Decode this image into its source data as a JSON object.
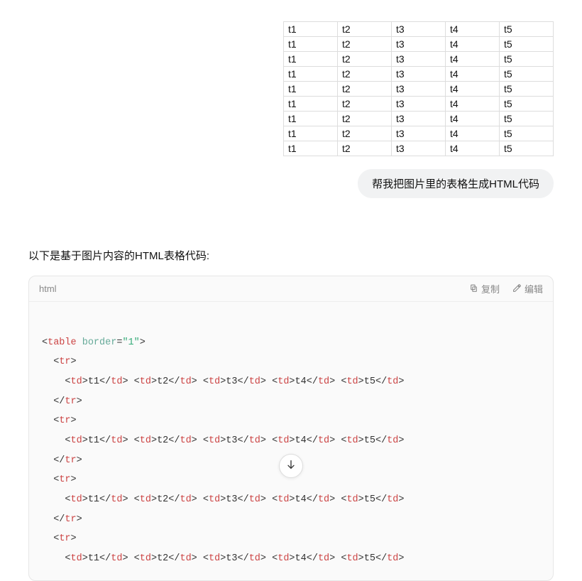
{
  "user": {
    "table_rows": [
      [
        "t1",
        "t2",
        "t3",
        "t4",
        "t5"
      ],
      [
        "t1",
        "t2",
        "t3",
        "t4",
        "t5"
      ],
      [
        "t1",
        "t2",
        "t3",
        "t4",
        "t5"
      ],
      [
        "t1",
        "t2",
        "t3",
        "t4",
        "t5"
      ],
      [
        "t1",
        "t2",
        "t3",
        "t4",
        "t5"
      ],
      [
        "t1",
        "t2",
        "t3",
        "t4",
        "t5"
      ],
      [
        "t1",
        "t2",
        "t3",
        "t4",
        "t5"
      ],
      [
        "t1",
        "t2",
        "t3",
        "t4",
        "t5"
      ],
      [
        "t1",
        "t2",
        "t3",
        "t4",
        "t5"
      ]
    ],
    "message": "帮我把图片里的表格生成HTML代码"
  },
  "assistant": {
    "intro": "以下是基于图片内容的HTML表格代码:",
    "code_lang": "html",
    "copy_label": "复制",
    "edit_label": "编辑",
    "code_lines": [
      "",
      [
        {
          "t": "brack",
          "v": "<"
        },
        {
          "t": "tag",
          "v": "table"
        },
        {
          "t": "text",
          "v": " "
        },
        {
          "t": "attr",
          "v": "border"
        },
        {
          "t": "text",
          "v": "="
        },
        {
          "t": "str",
          "v": "\"1\""
        },
        {
          "t": "brack",
          "v": ">"
        }
      ],
      [
        {
          "t": "text",
          "v": "  "
        },
        {
          "t": "brack",
          "v": "<"
        },
        {
          "t": "tag",
          "v": "tr"
        },
        {
          "t": "brack",
          "v": ">"
        }
      ],
      [
        {
          "t": "text",
          "v": "    "
        },
        {
          "t": "brack",
          "v": "<"
        },
        {
          "t": "tag",
          "v": "td"
        },
        {
          "t": "brack",
          "v": ">"
        },
        {
          "t": "text",
          "v": "t1"
        },
        {
          "t": "brack",
          "v": "</"
        },
        {
          "t": "tag",
          "v": "td"
        },
        {
          "t": "brack",
          "v": "> "
        },
        {
          "t": "brack",
          "v": "<"
        },
        {
          "t": "tag",
          "v": "td"
        },
        {
          "t": "brack",
          "v": ">"
        },
        {
          "t": "text",
          "v": "t2"
        },
        {
          "t": "brack",
          "v": "</"
        },
        {
          "t": "tag",
          "v": "td"
        },
        {
          "t": "brack",
          "v": "> "
        },
        {
          "t": "brack",
          "v": "<"
        },
        {
          "t": "tag",
          "v": "td"
        },
        {
          "t": "brack",
          "v": ">"
        },
        {
          "t": "text",
          "v": "t3"
        },
        {
          "t": "brack",
          "v": "</"
        },
        {
          "t": "tag",
          "v": "td"
        },
        {
          "t": "brack",
          "v": "> "
        },
        {
          "t": "brack",
          "v": "<"
        },
        {
          "t": "tag",
          "v": "td"
        },
        {
          "t": "brack",
          "v": ">"
        },
        {
          "t": "text",
          "v": "t4"
        },
        {
          "t": "brack",
          "v": "</"
        },
        {
          "t": "tag",
          "v": "td"
        },
        {
          "t": "brack",
          "v": "> "
        },
        {
          "t": "brack",
          "v": "<"
        },
        {
          "t": "tag",
          "v": "td"
        },
        {
          "t": "brack",
          "v": ">"
        },
        {
          "t": "text",
          "v": "t5"
        },
        {
          "t": "brack",
          "v": "</"
        },
        {
          "t": "tag",
          "v": "td"
        },
        {
          "t": "brack",
          "v": ">"
        }
      ],
      [
        {
          "t": "text",
          "v": "  "
        },
        {
          "t": "brack",
          "v": "</"
        },
        {
          "t": "tag",
          "v": "tr"
        },
        {
          "t": "brack",
          "v": ">"
        }
      ],
      [
        {
          "t": "text",
          "v": "  "
        },
        {
          "t": "brack",
          "v": "<"
        },
        {
          "t": "tag",
          "v": "tr"
        },
        {
          "t": "brack",
          "v": ">"
        }
      ],
      [
        {
          "t": "text",
          "v": "    "
        },
        {
          "t": "brack",
          "v": "<"
        },
        {
          "t": "tag",
          "v": "td"
        },
        {
          "t": "brack",
          "v": ">"
        },
        {
          "t": "text",
          "v": "t1"
        },
        {
          "t": "brack",
          "v": "</"
        },
        {
          "t": "tag",
          "v": "td"
        },
        {
          "t": "brack",
          "v": "> "
        },
        {
          "t": "brack",
          "v": "<"
        },
        {
          "t": "tag",
          "v": "td"
        },
        {
          "t": "brack",
          "v": ">"
        },
        {
          "t": "text",
          "v": "t2"
        },
        {
          "t": "brack",
          "v": "</"
        },
        {
          "t": "tag",
          "v": "td"
        },
        {
          "t": "brack",
          "v": "> "
        },
        {
          "t": "brack",
          "v": "<"
        },
        {
          "t": "tag",
          "v": "td"
        },
        {
          "t": "brack",
          "v": ">"
        },
        {
          "t": "text",
          "v": "t3"
        },
        {
          "t": "brack",
          "v": "</"
        },
        {
          "t": "tag",
          "v": "td"
        },
        {
          "t": "brack",
          "v": "> "
        },
        {
          "t": "brack",
          "v": "<"
        },
        {
          "t": "tag",
          "v": "td"
        },
        {
          "t": "brack",
          "v": ">"
        },
        {
          "t": "text",
          "v": "t4"
        },
        {
          "t": "brack",
          "v": "</"
        },
        {
          "t": "tag",
          "v": "td"
        },
        {
          "t": "brack",
          "v": "> "
        },
        {
          "t": "brack",
          "v": "<"
        },
        {
          "t": "tag",
          "v": "td"
        },
        {
          "t": "brack",
          "v": ">"
        },
        {
          "t": "text",
          "v": "t5"
        },
        {
          "t": "brack",
          "v": "</"
        },
        {
          "t": "tag",
          "v": "td"
        },
        {
          "t": "brack",
          "v": ">"
        }
      ],
      [
        {
          "t": "text",
          "v": "  "
        },
        {
          "t": "brack",
          "v": "</"
        },
        {
          "t": "tag",
          "v": "tr"
        },
        {
          "t": "brack",
          "v": ">"
        }
      ],
      [
        {
          "t": "text",
          "v": "  "
        },
        {
          "t": "brack",
          "v": "<"
        },
        {
          "t": "tag",
          "v": "tr"
        },
        {
          "t": "brack",
          "v": ">"
        }
      ],
      [
        {
          "t": "text",
          "v": "    "
        },
        {
          "t": "brack",
          "v": "<"
        },
        {
          "t": "tag",
          "v": "td"
        },
        {
          "t": "brack",
          "v": ">"
        },
        {
          "t": "text",
          "v": "t1"
        },
        {
          "t": "brack",
          "v": "</"
        },
        {
          "t": "tag",
          "v": "td"
        },
        {
          "t": "brack",
          "v": "> "
        },
        {
          "t": "brack",
          "v": "<"
        },
        {
          "t": "tag",
          "v": "td"
        },
        {
          "t": "brack",
          "v": ">"
        },
        {
          "t": "text",
          "v": "t2"
        },
        {
          "t": "brack",
          "v": "</"
        },
        {
          "t": "tag",
          "v": "td"
        },
        {
          "t": "brack",
          "v": "> "
        },
        {
          "t": "brack",
          "v": "<"
        },
        {
          "t": "tag",
          "v": "td"
        },
        {
          "t": "brack",
          "v": ">"
        },
        {
          "t": "text",
          "v": "t3"
        },
        {
          "t": "brack",
          "v": "</"
        },
        {
          "t": "tag",
          "v": "td"
        },
        {
          "t": "brack",
          "v": "> "
        },
        {
          "t": "brack",
          "v": "<"
        },
        {
          "t": "tag",
          "v": "td"
        },
        {
          "t": "brack",
          "v": ">"
        },
        {
          "t": "text",
          "v": "t4"
        },
        {
          "t": "brack",
          "v": "</"
        },
        {
          "t": "tag",
          "v": "td"
        },
        {
          "t": "brack",
          "v": "> "
        },
        {
          "t": "brack",
          "v": "<"
        },
        {
          "t": "tag",
          "v": "td"
        },
        {
          "t": "brack",
          "v": ">"
        },
        {
          "t": "text",
          "v": "t5"
        },
        {
          "t": "brack",
          "v": "</"
        },
        {
          "t": "tag",
          "v": "td"
        },
        {
          "t": "brack",
          "v": ">"
        }
      ],
      [
        {
          "t": "text",
          "v": "  "
        },
        {
          "t": "brack",
          "v": "</"
        },
        {
          "t": "tag",
          "v": "tr"
        },
        {
          "t": "brack",
          "v": ">"
        }
      ],
      [
        {
          "t": "text",
          "v": "  "
        },
        {
          "t": "brack",
          "v": "<"
        },
        {
          "t": "tag",
          "v": "tr"
        },
        {
          "t": "brack",
          "v": ">"
        }
      ],
      [
        {
          "t": "text",
          "v": "    "
        },
        {
          "t": "brack",
          "v": "<"
        },
        {
          "t": "tag",
          "v": "td"
        },
        {
          "t": "brack",
          "v": ">"
        },
        {
          "t": "text",
          "v": "t1"
        },
        {
          "t": "brack",
          "v": "</"
        },
        {
          "t": "tag",
          "v": "td"
        },
        {
          "t": "brack",
          "v": "> "
        },
        {
          "t": "brack",
          "v": "<"
        },
        {
          "t": "tag",
          "v": "td"
        },
        {
          "t": "brack",
          "v": ">"
        },
        {
          "t": "text",
          "v": "t2"
        },
        {
          "t": "brack",
          "v": "</"
        },
        {
          "t": "tag",
          "v": "td"
        },
        {
          "t": "brack",
          "v": "> "
        },
        {
          "t": "brack",
          "v": "<"
        },
        {
          "t": "tag",
          "v": "td"
        },
        {
          "t": "brack",
          "v": ">"
        },
        {
          "t": "text",
          "v": "t3"
        },
        {
          "t": "brack",
          "v": "</"
        },
        {
          "t": "tag",
          "v": "td"
        },
        {
          "t": "brack",
          "v": "> "
        },
        {
          "t": "brack",
          "v": "<"
        },
        {
          "t": "tag",
          "v": "td"
        },
        {
          "t": "brack",
          "v": ">"
        },
        {
          "t": "text",
          "v": "t4"
        },
        {
          "t": "brack",
          "v": "</"
        },
        {
          "t": "tag",
          "v": "td"
        },
        {
          "t": "brack",
          "v": "> "
        },
        {
          "t": "brack",
          "v": "<"
        },
        {
          "t": "tag",
          "v": "td"
        },
        {
          "t": "brack",
          "v": ">"
        },
        {
          "t": "text",
          "v": "t5"
        },
        {
          "t": "brack",
          "v": "</"
        },
        {
          "t": "tag",
          "v": "td"
        },
        {
          "t": "brack",
          "v": ">"
        }
      ]
    ]
  }
}
